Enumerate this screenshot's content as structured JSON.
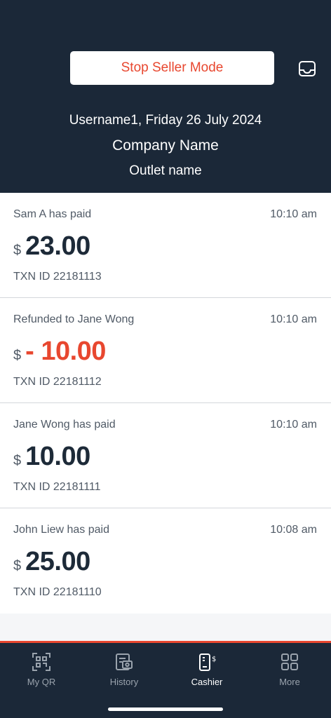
{
  "header": {
    "stop_button_label": "Stop Seller Mode",
    "user_line": "Username1, Friday 26 July 2024",
    "company": "Company Name",
    "outlet": "Outlet name",
    "inbox_icon": "inbox-icon"
  },
  "transactions": [
    {
      "description": "Sam A has paid",
      "time": "10:10 am",
      "currency": "$",
      "amount": "23.00",
      "txn_id": "TXN ID 22181113"
    },
    {
      "description": "Refunded to Jane Wong",
      "time": "10:10 am",
      "currency": "$",
      "amount": "- 10.00",
      "txn_id": "TXN ID 22181112"
    },
    {
      "description": "Jane Wong has paid",
      "time": "10:10 am",
      "currency": "$",
      "amount": "10.00",
      "txn_id": "TXN ID 22181111"
    },
    {
      "description": "John Liew has paid",
      "time": "10:08 am",
      "currency": "$",
      "amount": "25.00",
      "txn_id": "TXN ID 22181110"
    }
  ],
  "nav": {
    "items": [
      {
        "label": "My QR",
        "icon": "qr-code-icon"
      },
      {
        "label": "History",
        "icon": "history-icon"
      },
      {
        "label": "Cashier",
        "icon": "cashier-icon",
        "active": true
      },
      {
        "label": "More",
        "icon": "grid-icon"
      }
    ]
  },
  "colors": {
    "header_bg": "#1b2838",
    "accent": "#e8472f",
    "text_primary": "#1d2a38",
    "text_secondary": "#505a66"
  }
}
